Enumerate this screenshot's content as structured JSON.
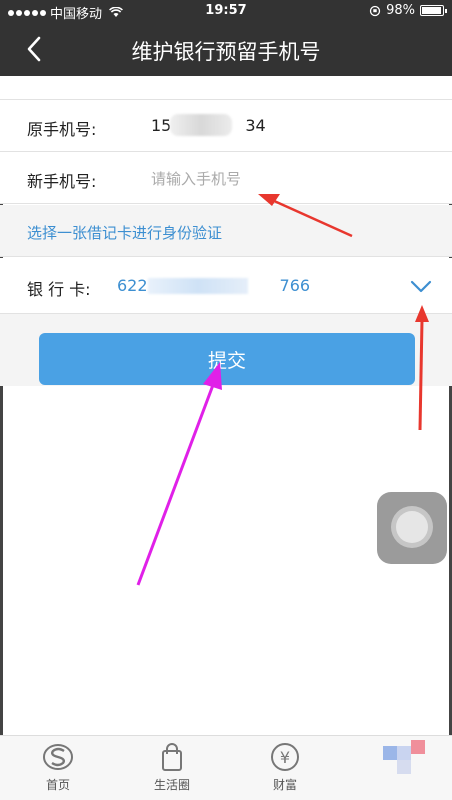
{
  "status_bar": {
    "carrier": "中国移动",
    "time": "19:57",
    "battery": "98%"
  },
  "nav": {
    "title": "维护银行预留手机号"
  },
  "form": {
    "old_phone_label": "原手机号:",
    "old_phone_prefix": "15",
    "old_phone_suffix": "34",
    "new_phone_label": "新手机号:",
    "new_phone_placeholder": "请输入手机号",
    "new_phone_value": ""
  },
  "verify": {
    "link_text": "选择一张借记卡进行身份验证"
  },
  "card": {
    "label": "银 行 卡:",
    "number_prefix": "622",
    "number_suffix": "766"
  },
  "submit": {
    "label": "提交"
  },
  "tabs": [
    {
      "label": "首页",
      "icon": "home-logo-icon"
    },
    {
      "label": "生活圈",
      "icon": "shopping-bag-icon"
    },
    {
      "label": "财富",
      "icon": "yuan-coin-icon"
    }
  ],
  "colors": {
    "header_bg": "#333333",
    "link_blue": "#3d8fd1",
    "button_blue": "#4aa1e4",
    "annotation_red": "#e8372e",
    "annotation_magenta": "#e020e8"
  }
}
